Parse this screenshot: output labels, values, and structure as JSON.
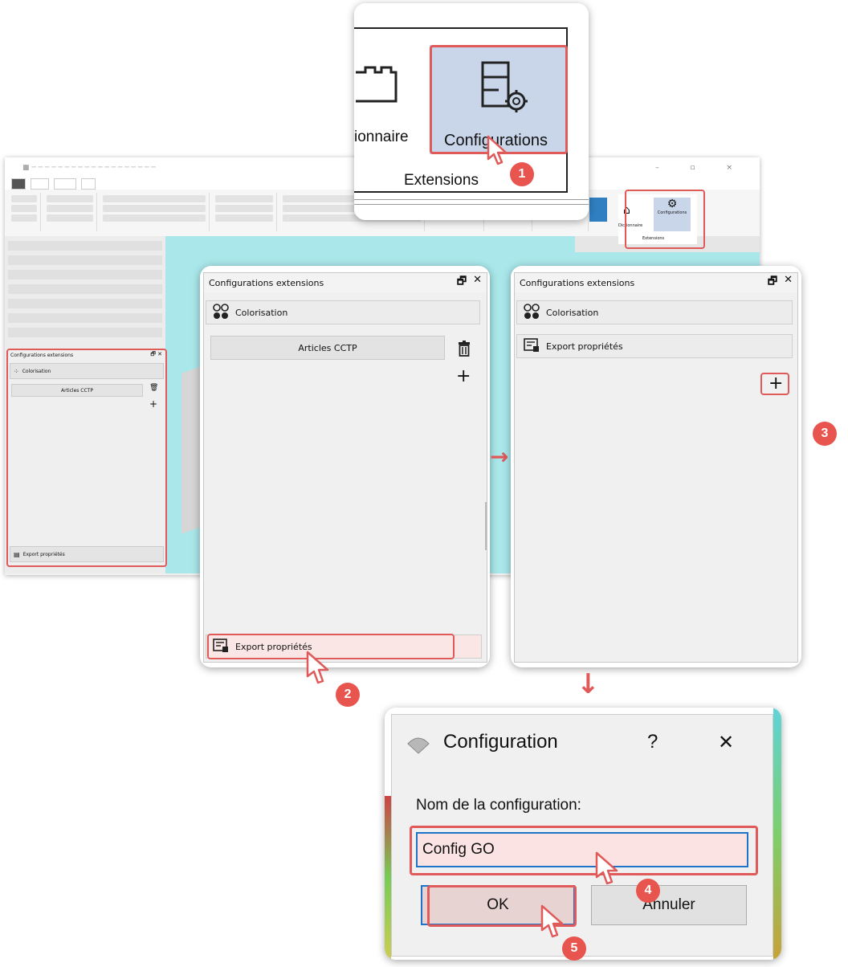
{
  "colors": {
    "accent": "#e05a5a",
    "badge": "#e8544e",
    "select_blue": "#c9d6ea",
    "focus_blue": "#1f73c8"
  },
  "ribbon_zoom": {
    "left_label": "ionnaire",
    "configurations_label": "Configurations",
    "group_label": "Extensions",
    "step": "1"
  },
  "bg_app": {
    "mini_panel_title": "Configurations extensions",
    "mini_colorisation": "Colorisation",
    "mini_articles": "Articles CCTP",
    "mini_export": "Export propriétés",
    "mini_dict_label": "Dictionnaire",
    "mini_conf_label": "Configurations",
    "mini_ext_label": "Extensions"
  },
  "panel_left": {
    "title": "Configurations extensions",
    "colorisation": "Colorisation",
    "articles": "Articles CCTP",
    "export": "Export propriétés",
    "step": "2"
  },
  "panel_right": {
    "title": "Configurations extensions",
    "colorisation": "Colorisation",
    "export": "Export propriétés",
    "step": "3"
  },
  "dialog": {
    "title": "Configuration",
    "help": "?",
    "close": "✕",
    "label": "Nom de la configuration:",
    "value": "Config GO",
    "ok": "OK",
    "cancel": "Annuler",
    "step_input": "4",
    "step_ok": "5"
  },
  "icons": {
    "plus": "+",
    "trash": "trash-icon",
    "restore": "🗗",
    "close": "✕"
  }
}
